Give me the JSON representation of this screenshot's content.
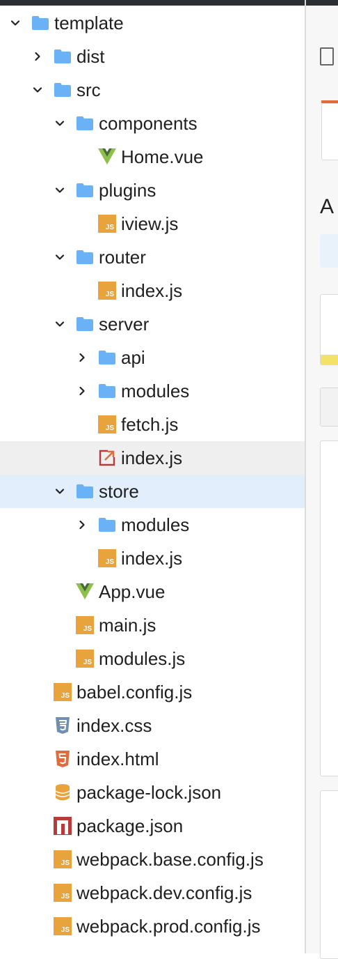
{
  "tree": [
    {
      "label": "template",
      "depth": 0,
      "type": "folder",
      "expanded": true
    },
    {
      "label": "dist",
      "depth": 1,
      "type": "folder",
      "expanded": false
    },
    {
      "label": "src",
      "depth": 1,
      "type": "folder",
      "expanded": true
    },
    {
      "label": "components",
      "depth": 2,
      "type": "folder",
      "expanded": true
    },
    {
      "label": "Home.vue",
      "depth": 3,
      "type": "vue"
    },
    {
      "label": "plugins",
      "depth": 2,
      "type": "folder",
      "expanded": true
    },
    {
      "label": "iview.js",
      "depth": 3,
      "type": "js"
    },
    {
      "label": "router",
      "depth": 2,
      "type": "folder",
      "expanded": true
    },
    {
      "label": "index.js",
      "depth": 3,
      "type": "js"
    },
    {
      "label": "server",
      "depth": 2,
      "type": "folder",
      "expanded": true
    },
    {
      "label": "api",
      "depth": 3,
      "type": "folder",
      "expanded": false
    },
    {
      "label": "modules",
      "depth": 3,
      "type": "folder",
      "expanded": false
    },
    {
      "label": "fetch.js",
      "depth": 3,
      "type": "js"
    },
    {
      "label": "index.js",
      "depth": 3,
      "type": "export",
      "state": "hover"
    },
    {
      "label": "store",
      "depth": 2,
      "type": "folder",
      "expanded": true,
      "state": "selected"
    },
    {
      "label": "modules",
      "depth": 3,
      "type": "folder",
      "expanded": false
    },
    {
      "label": "index.js",
      "depth": 3,
      "type": "js"
    },
    {
      "label": "App.vue",
      "depth": 2,
      "type": "vue"
    },
    {
      "label": "main.js",
      "depth": 2,
      "type": "js"
    },
    {
      "label": "modules.js",
      "depth": 2,
      "type": "js"
    },
    {
      "label": "babel.config.js",
      "depth": 1,
      "type": "js"
    },
    {
      "label": "index.css",
      "depth": 1,
      "type": "css"
    },
    {
      "label": "index.html",
      "depth": 1,
      "type": "html"
    },
    {
      "label": "package-lock.json",
      "depth": 1,
      "type": "lock"
    },
    {
      "label": "package.json",
      "depth": 1,
      "type": "npm"
    },
    {
      "label": "webpack.base.config.js",
      "depth": 1,
      "type": "js"
    },
    {
      "label": "webpack.dev.config.js",
      "depth": 1,
      "type": "js"
    },
    {
      "label": "webpack.prod.config.js",
      "depth": 1,
      "type": "js"
    }
  ],
  "right_panel": {
    "heading_letter": "A"
  },
  "icons": {
    "folder": "folder-icon",
    "vue": "vue-file-icon",
    "js": "js-file-icon",
    "css": "css-file-icon",
    "html": "html-file-icon",
    "lock": "database-icon",
    "npm": "npm-icon",
    "export": "external-link-icon"
  },
  "colors": {
    "folder": "#6bb1f5",
    "js": "#e8a33d",
    "vue_outer": "#8dc149",
    "vue_inner": "#4a6b33",
    "css": "#6f8fb0",
    "html": "#e06c3c",
    "lock": "#e8a33d",
    "npm": "#b83b3b",
    "selected_bg": "#e2eefc",
    "hover_bg": "#efefef"
  }
}
